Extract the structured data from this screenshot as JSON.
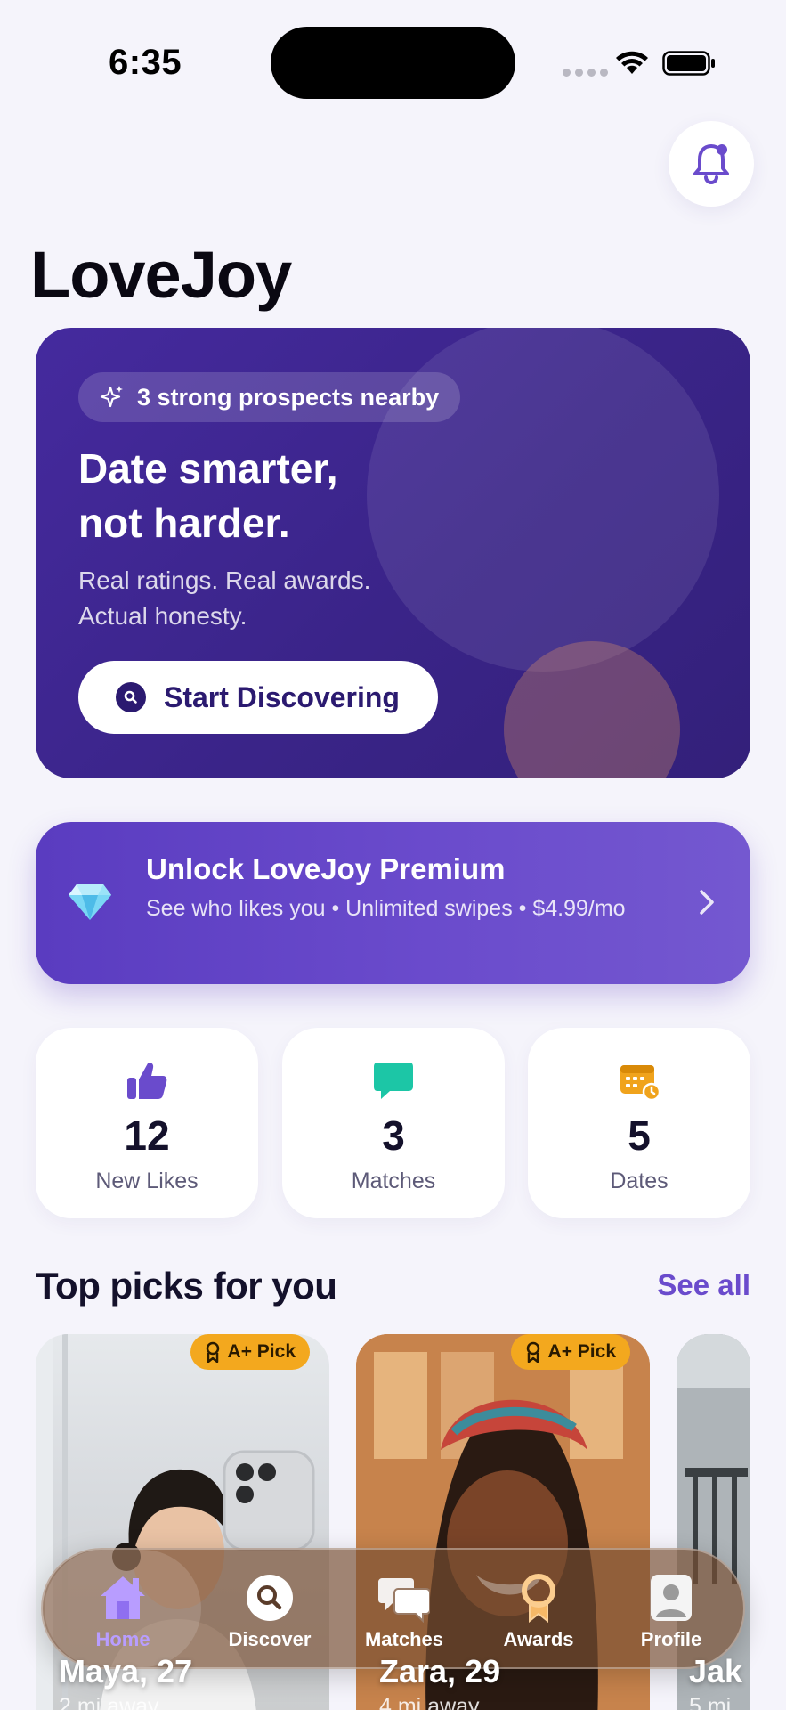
{
  "status_bar": {
    "time": "6:35"
  },
  "app": {
    "title": "LoveJoy"
  },
  "hero": {
    "badge": "3 strong prospects nearby",
    "heading_line1": "Date smarter,",
    "heading_line2": "not harder.",
    "subtitle_line1": "Real ratings. Real awards.",
    "subtitle_line2": "Actual honesty.",
    "cta_label": "Start Discovering"
  },
  "premium": {
    "title": "Unlock LoveJoy Premium",
    "description": "See who likes you • Unlimited swipes • $4.99/mo",
    "icon": "gem-icon"
  },
  "stats": [
    {
      "value": "12",
      "label": "New Likes",
      "icon": "thumbs-up-icon",
      "color": "#6a4bcc"
    },
    {
      "value": "3",
      "label": "Matches",
      "icon": "chat-bubble-icon",
      "color": "#1cc6a6"
    },
    {
      "value": "5",
      "label": "Dates",
      "icon": "calendar-icon",
      "color": "#f0a31c"
    }
  ],
  "picks": {
    "title": "Top picks for you",
    "see_all": "See all",
    "items": [
      {
        "badge": "A+ Pick",
        "name": "Maya, 27",
        "distance": "2 mi away"
      },
      {
        "badge": "A+ Pick",
        "name": "Zara, 29",
        "distance": "4 mi away"
      },
      {
        "badge": "",
        "name": "Jak",
        "distance": "5 mi"
      }
    ]
  },
  "tabs": [
    {
      "label": "Home",
      "icon": "home-icon",
      "active": true
    },
    {
      "label": "Discover",
      "icon": "search-icon",
      "active": false
    },
    {
      "label": "Matches",
      "icon": "chat-bubbles-icon",
      "active": false
    },
    {
      "label": "Awards",
      "icon": "award-icon",
      "active": false
    },
    {
      "label": "Profile",
      "icon": "profile-icon",
      "active": false
    }
  ],
  "colors": {
    "brand_purple": "#6a4bcc",
    "hero_bg": "#3a2488",
    "badge_gold": "#f3a81e",
    "tab_active": "#b89dff"
  }
}
